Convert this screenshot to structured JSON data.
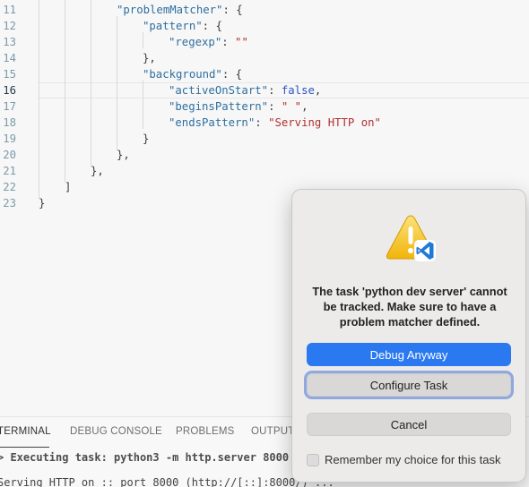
{
  "editor": {
    "active_line": "16",
    "lines": [
      {
        "num": "11",
        "indent": 12,
        "parts": [
          [
            "tk-key",
            "\"problemMatcher\""
          ],
          [
            "tk-p",
            ": {"
          ]
        ]
      },
      {
        "num": "12",
        "indent": 16,
        "parts": [
          [
            "tk-key",
            "\"pattern\""
          ],
          [
            "tk-p",
            ": {"
          ]
        ]
      },
      {
        "num": "13",
        "indent": 20,
        "parts": [
          [
            "tk-key",
            "\"regexp\""
          ],
          [
            "tk-p",
            ": "
          ],
          [
            "tk-str",
            "\"\""
          ]
        ]
      },
      {
        "num": "14",
        "indent": 16,
        "parts": [
          [
            "tk-p",
            "},"
          ]
        ]
      },
      {
        "num": "15",
        "indent": 16,
        "parts": [
          [
            "tk-key",
            "\"background\""
          ],
          [
            "tk-p",
            ": {"
          ]
        ]
      },
      {
        "num": "16",
        "indent": 20,
        "parts": [
          [
            "tk-key",
            "\"activeOnStart\""
          ],
          [
            "tk-p",
            ": "
          ],
          [
            "tk-kw",
            "false"
          ],
          [
            "tk-p",
            ","
          ]
        ]
      },
      {
        "num": "17",
        "indent": 20,
        "parts": [
          [
            "tk-key",
            "\"beginsPattern\""
          ],
          [
            "tk-p",
            ": "
          ],
          [
            "tk-str",
            "\" \""
          ],
          [
            "tk-p",
            ","
          ]
        ]
      },
      {
        "num": "18",
        "indent": 20,
        "parts": [
          [
            "tk-key",
            "\"endsPattern\""
          ],
          [
            "tk-p",
            ": "
          ],
          [
            "tk-str",
            "\"Serving HTTP on\""
          ]
        ]
      },
      {
        "num": "19",
        "indent": 16,
        "parts": [
          [
            "tk-p",
            "}"
          ]
        ]
      },
      {
        "num": "20",
        "indent": 12,
        "parts": [
          [
            "tk-p",
            "},"
          ]
        ]
      },
      {
        "num": "21",
        "indent": 8,
        "parts": [
          [
            "tk-p",
            "},"
          ]
        ]
      },
      {
        "num": "22",
        "indent": 4,
        "parts": [
          [
            "tk-p",
            "]"
          ]
        ]
      },
      {
        "num": "23",
        "indent": 0,
        "parts": [
          [
            "tk-p",
            "}"
          ]
        ]
      }
    ]
  },
  "panel": {
    "tabs": {
      "terminal": "TERMINAL",
      "debug_console": "DEBUG CONSOLE",
      "problems": "PROBLEMS",
      "output": "OUTPUT"
    },
    "terminal_line1": "> Executing task: python3 -m http.server 8000 <",
    "terminal_line2": "Serving HTTP on :: port 8000 (http://[::]:8000/) ..."
  },
  "dialog": {
    "message": "The task 'python dev server' cannot be tracked. Make sure to have a problem matcher defined.",
    "debug_anyway": "Debug Anyway",
    "configure_task": "Configure Task",
    "cancel": "Cancel",
    "remember_label": "Remember my choice for this task",
    "remember_checked": false,
    "icon": "warning-icon",
    "badge_icon": "vscode-icon",
    "colors": {
      "primary_button": "#2a79f0",
      "focus_ring": "#8fa8e0",
      "warning_yellow": "#f5c518",
      "vscode_blue": "#1f7ad6"
    }
  }
}
